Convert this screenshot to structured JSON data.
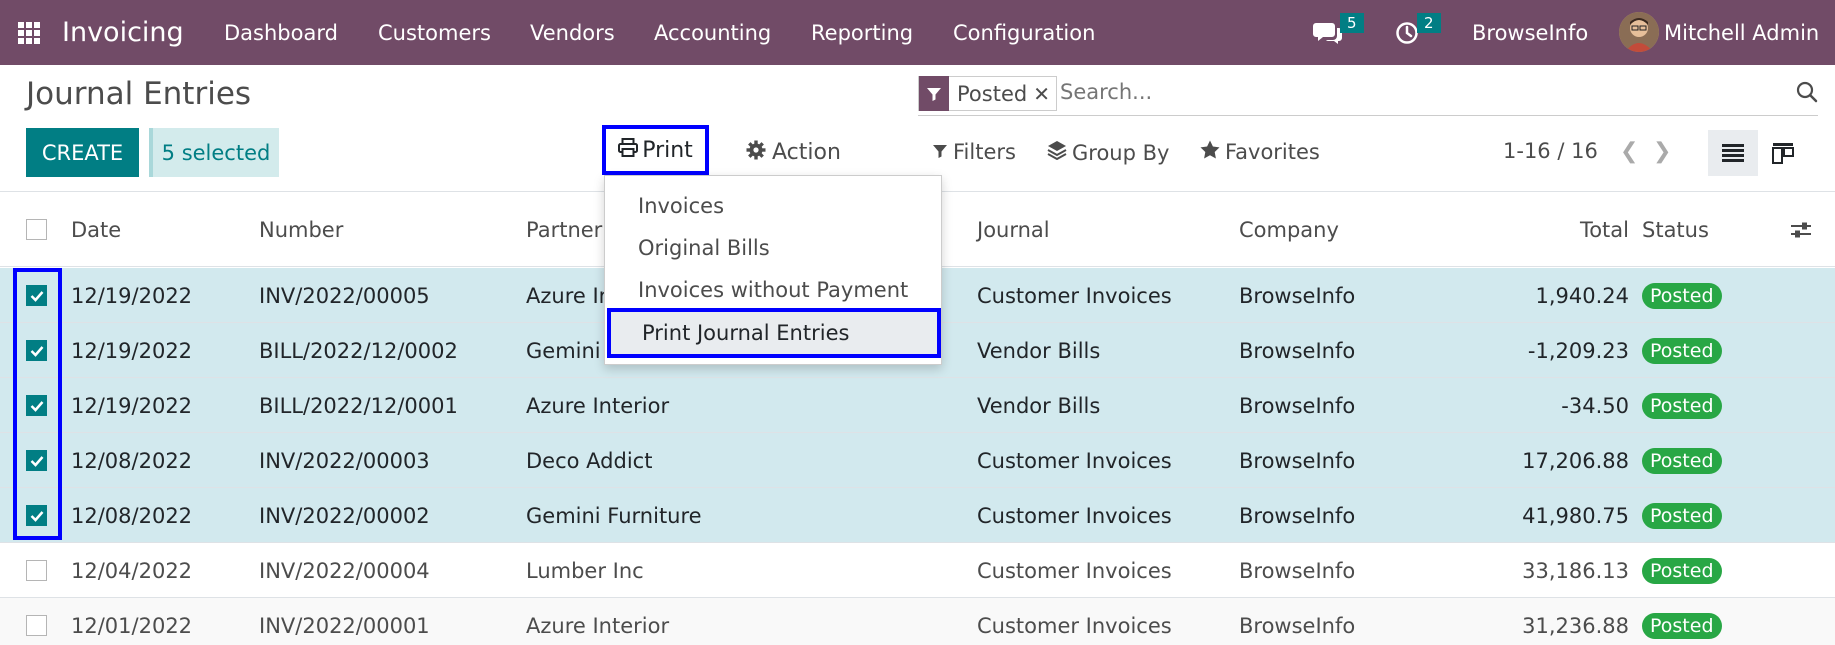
{
  "nav": {
    "app_name": "Invoicing",
    "items": [
      "Dashboard",
      "Customers",
      "Vendors",
      "Accounting",
      "Reporting",
      "Configuration"
    ],
    "messages_count": "5",
    "activities_count": "2",
    "company": "BrowseInfo",
    "user": "Mitchell Admin"
  },
  "page": {
    "title": "Journal Entries",
    "create_label": "CREATE",
    "selected_label": "5 selected",
    "print_label": "Print",
    "action_label": "Action"
  },
  "search": {
    "facet": "Posted",
    "placeholder": "Search..."
  },
  "filters": {
    "filters_label": "Filters",
    "groupby_label": "Group By",
    "favorites_label": "Favorites",
    "pager": "1-16 / 16"
  },
  "print_menu": {
    "items": [
      "Invoices",
      "Original Bills",
      "Invoices without Payment",
      "Print Journal Entries"
    ]
  },
  "table": {
    "headers": {
      "date": "Date",
      "number": "Number",
      "partner": "Partner",
      "journal": "Journal",
      "company": "Company",
      "total": "Total",
      "status": "Status"
    },
    "rows": [
      {
        "date": "12/19/2022",
        "number": "INV/2022/00005",
        "partner": "Azure In",
        "journal": "Customer Invoices",
        "company": "BrowseInfo",
        "total": "1,940.24",
        "status": "Posted",
        "selected": true
      },
      {
        "date": "12/19/2022",
        "number": "BILL/2022/12/0002",
        "partner": "Gemini",
        "journal": "Vendor Bills",
        "company": "BrowseInfo",
        "total": "-1,209.23",
        "status": "Posted",
        "selected": true
      },
      {
        "date": "12/19/2022",
        "number": "BILL/2022/12/0001",
        "partner": "Azure Interior",
        "journal": "Vendor Bills",
        "company": "BrowseInfo",
        "total": "-34.50",
        "status": "Posted",
        "selected": true
      },
      {
        "date": "12/08/2022",
        "number": "INV/2022/00003",
        "partner": "Deco Addict",
        "journal": "Customer Invoices",
        "company": "BrowseInfo",
        "total": "17,206.88",
        "status": "Posted",
        "selected": true
      },
      {
        "date": "12/08/2022",
        "number": "INV/2022/00002",
        "partner": "Gemini Furniture",
        "journal": "Customer Invoices",
        "company": "BrowseInfo",
        "total": "41,980.75",
        "status": "Posted",
        "selected": true
      },
      {
        "date": "12/04/2022",
        "number": "INV/2022/00004",
        "partner": "Lumber Inc",
        "journal": "Customer Invoices",
        "company": "BrowseInfo",
        "total": "33,186.13",
        "status": "Posted",
        "selected": false
      },
      {
        "date": "12/01/2022",
        "number": "INV/2022/00001",
        "partner": "Azure Interior",
        "journal": "Customer Invoices",
        "company": "BrowseInfo",
        "total": "31,236.88",
        "status": "Posted",
        "selected": false
      }
    ]
  }
}
